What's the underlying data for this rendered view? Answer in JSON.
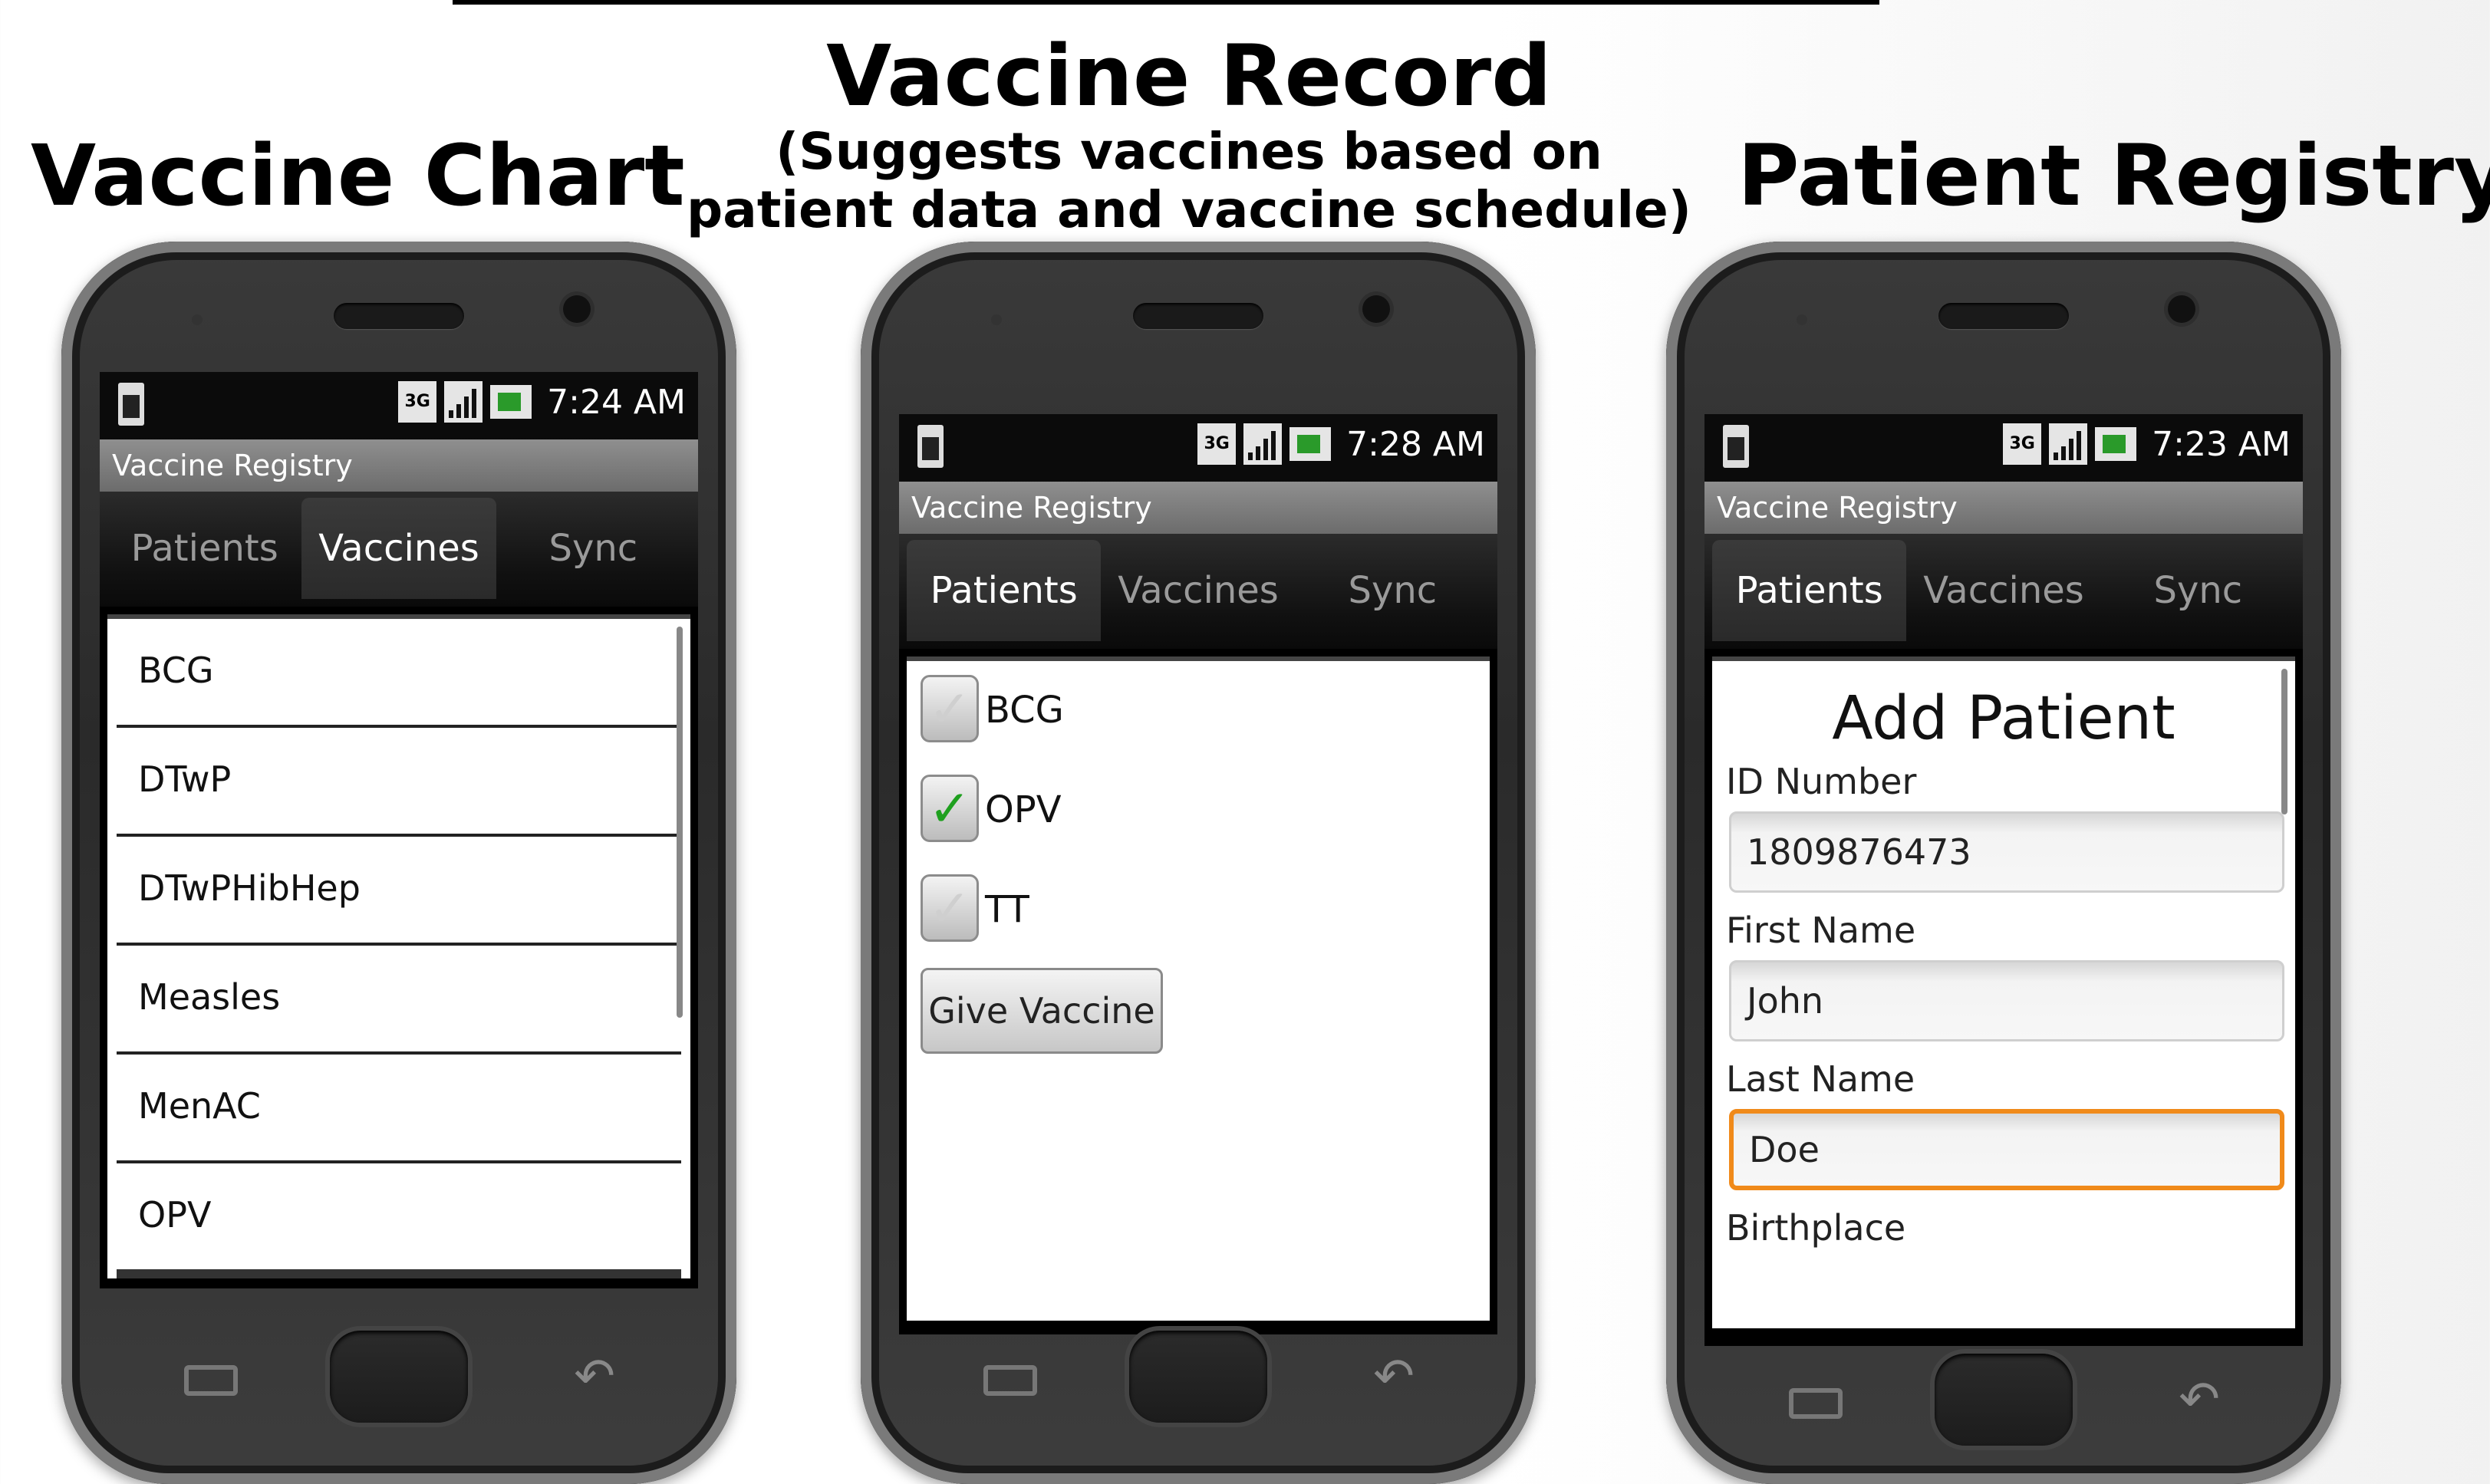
{
  "titles": {
    "left": "Vaccine Chart",
    "middle": "Vaccine Record",
    "middle_sub": "(Suggests vaccines based on patient data and vaccine schedule)",
    "right": "Patient Registry"
  },
  "status_icons": {
    "network": "3G",
    "signal_icon": "signal-icon",
    "battery_icon": "battery-icon",
    "sim_icon": "sim-icon"
  },
  "app_name": "Vaccine Registry",
  "tabs": [
    "Patients",
    "Vaccines",
    "Sync"
  ],
  "phone_left": {
    "time": "7:24 AM",
    "active_tab": "Vaccines",
    "vaccines": [
      "BCG",
      "DTwP",
      "DTwPHibHep",
      "Measles",
      "MenAC",
      "OPV"
    ]
  },
  "phone_middle": {
    "time": "7:28 AM",
    "active_tab": "Patients",
    "vaccine_checks": [
      {
        "label": "BCG",
        "checked": false
      },
      {
        "label": "OPV",
        "checked": true
      },
      {
        "label": "TT",
        "checked": false
      }
    ],
    "give_button": "Give Vaccine"
  },
  "phone_right": {
    "time": "7:23 AM",
    "active_tab": "Patients",
    "form_title": "Add Patient",
    "fields": [
      {
        "label": "ID Number",
        "value": "1809876473"
      },
      {
        "label": "First Name",
        "value": "John"
      },
      {
        "label": "Last Name",
        "value": "Doe"
      }
    ],
    "next_label": "Birthplace"
  },
  "colors": {
    "focus_border": "#f08a1a",
    "check_green": "#1fa01f"
  }
}
